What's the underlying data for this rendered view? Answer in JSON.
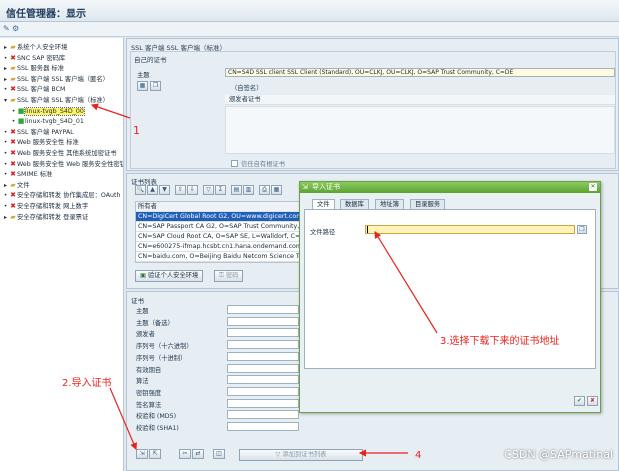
{
  "window": {
    "title": "信任管理器：显示"
  },
  "tree": {
    "items": [
      {
        "label": "系统个人安全环境",
        "marker": "▸",
        "icon": "folder-icon",
        "kind": "folder",
        "indent": 0
      },
      {
        "label": "SNC SAP 密码库",
        "marker": "•",
        "icon": "x-icon",
        "kind": "x",
        "indent": 0
      },
      {
        "label": "SSL 服务器 标准",
        "marker": "▸",
        "icon": "folder-icon",
        "kind": "folder",
        "indent": 0
      },
      {
        "label": "SSL 客户端 SSL 客户端（匿名）",
        "marker": "▸",
        "icon": "folder-icon",
        "kind": "folder",
        "indent": 0
      },
      {
        "label": "SSL 客户端 BCM",
        "marker": "•",
        "icon": "x-icon",
        "kind": "x",
        "indent": 0
      },
      {
        "label": "SSL 客户端 SSL 客户端（标准）",
        "marker": "▾",
        "icon": "folder-icon",
        "kind": "folder",
        "indent": 0
      },
      {
        "label": "linux-tvgb_S4D_00",
        "marker": "•",
        "icon": "green-square-icon",
        "kind": "green",
        "indent": 1,
        "selected": true
      },
      {
        "label": "linux-tvgb_S4D_01",
        "marker": "•",
        "icon": "green-square-icon",
        "kind": "green",
        "indent": 1
      },
      {
        "label": "SSL 客户端 PAYPAL",
        "marker": "•",
        "icon": "x-icon",
        "kind": "x",
        "indent": 0
      },
      {
        "label": "Web 服务安全性 标准",
        "marker": "•",
        "icon": "x-icon",
        "kind": "x",
        "indent": 0
      },
      {
        "label": "Web 服务安全性 其他系统加密证书",
        "marker": "•",
        "icon": "x-icon",
        "kind": "x",
        "indent": 0
      },
      {
        "label": "Web 服务安全性 Web 服务安全性密钥",
        "marker": "•",
        "icon": "x-icon",
        "kind": "x",
        "indent": 0
      },
      {
        "label": "SMIME 标准",
        "marker": "•",
        "icon": "x-icon",
        "kind": "x",
        "indent": 0
      },
      {
        "label": "文件",
        "marker": "▸",
        "icon": "folder-icon",
        "kind": "folder",
        "indent": 0
      },
      {
        "label": "安全存储和转发 协作集成层：OAuth",
        "marker": "•",
        "icon": "x-icon",
        "kind": "x",
        "indent": 0
      },
      {
        "label": "安全存储和转发 网上数字",
        "marker": "•",
        "icon": "x-icon",
        "kind": "x",
        "indent": 0
      },
      {
        "label": "安全存储和转发 登录票证",
        "marker": "▸",
        "icon": "folder-icon",
        "kind": "folder",
        "indent": 0
      }
    ]
  },
  "pse": {
    "header": "SSL 客户端 SSL 客户端（标准）",
    "own_cert_title": "自己的证书",
    "subject_label": "主题",
    "subject_value": "CN=S4D SSL client SSL Client (Standard), OU=CLKJ, OU=CLKJ, O=SAP Trust Community, C=DE",
    "self_signed": "（自签名）",
    "issuer_cert_label": "颁发者证书",
    "checkbox_label": "信任自有根证书"
  },
  "cert_list": {
    "title": "证书列表",
    "column": "所有者",
    "rows": [
      "CN=DigiCert Global Root G2, OU=www.digicert.com, C",
      "CN=SAP Passport CA G2, O=SAP Trust Community, C=",
      "CN=SAP Cloud Root CA, O=SAP SE, L=Walldorf, C=DE",
      "CN=e600275-ifmap.hcsbt.cn1.hana.ondemand.com, C",
      "CN=baidu.com, O=Beijing Baidu Netcom Science Tech"
    ],
    "verify_button": "验证个人安全环境",
    "password_button": "密码"
  },
  "cert_detail": {
    "title": "证书",
    "labels": [
      "主题",
      "主题（备选）",
      "颁发者",
      "序列号（十六进制）",
      "序列号（十进制）",
      "有效期自",
      "算法",
      "密钥强度",
      "签名算法",
      "校验和 (MD5)",
      "校验和 (SHA1)"
    ],
    "add_button": "添加到证书列表"
  },
  "dialog": {
    "title": "导入证书",
    "tabs": [
      "文件",
      "数据库",
      "地址簿",
      "目录服务"
    ],
    "file_path_label": "文件路径",
    "file_path_value": ""
  },
  "annotations": {
    "one": "1",
    "two": "2.导入证书",
    "three": "3.选择下载下来的证书地址",
    "four": "4"
  },
  "watermark": "CSDN @SAPmatinal",
  "colors": {
    "annotation": "#e8231e",
    "dialog_green": "#5aa232",
    "highlight": "#1f5fb8"
  }
}
